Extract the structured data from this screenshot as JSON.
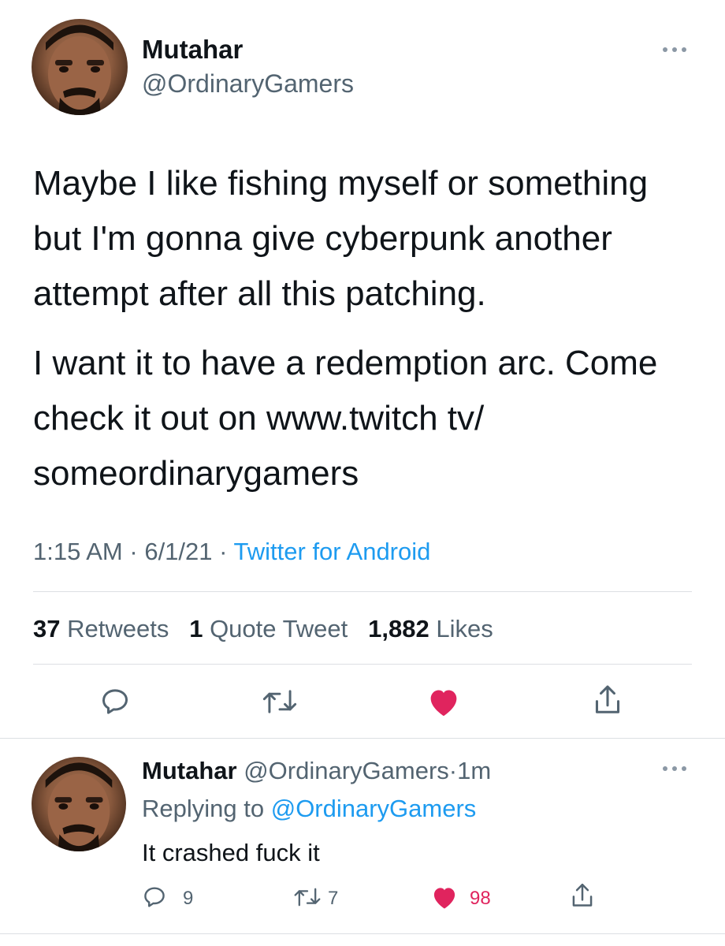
{
  "tweet": {
    "author_name": "Mutahar",
    "author_handle": "@OrdinaryGamers",
    "more_icon": "more-dots-icon",
    "paragraphs": [
      "Maybe I like fishing myself or something but I'm gonna give cyberpunk another attempt after all this patching.",
      "I want it to have a redemption arc. Come check it out on www.twitch tv/ someordinarygamers"
    ],
    "time": "1:15 AM",
    "date": "6/1/21",
    "separator": "·",
    "source": "Twitter for Android",
    "stats": {
      "retweets_count": "37",
      "retweets_label": "Retweets",
      "quotes_count": "1",
      "quotes_label": "Quote Tweet",
      "likes_count": "1,882",
      "likes_label": "Likes"
    },
    "actions": [
      "reply-icon",
      "retweet-icon",
      "like-icon",
      "share-icon"
    ],
    "liked": true
  },
  "reply": {
    "author_name": "Mutahar",
    "author_handle": "@OrdinaryGamers",
    "separator": "·",
    "age": "1m",
    "replying_label": "Replying to",
    "replying_to": "@OrdinaryGamers",
    "text": "It crashed fuck it",
    "reply_count": "9",
    "retweet_count": "7",
    "like_count": "98",
    "liked": true
  },
  "colors": {
    "accent": "#1d9bf0",
    "like": "#e0245e",
    "secondary_text": "#536471",
    "primary_text": "#0f1419"
  }
}
